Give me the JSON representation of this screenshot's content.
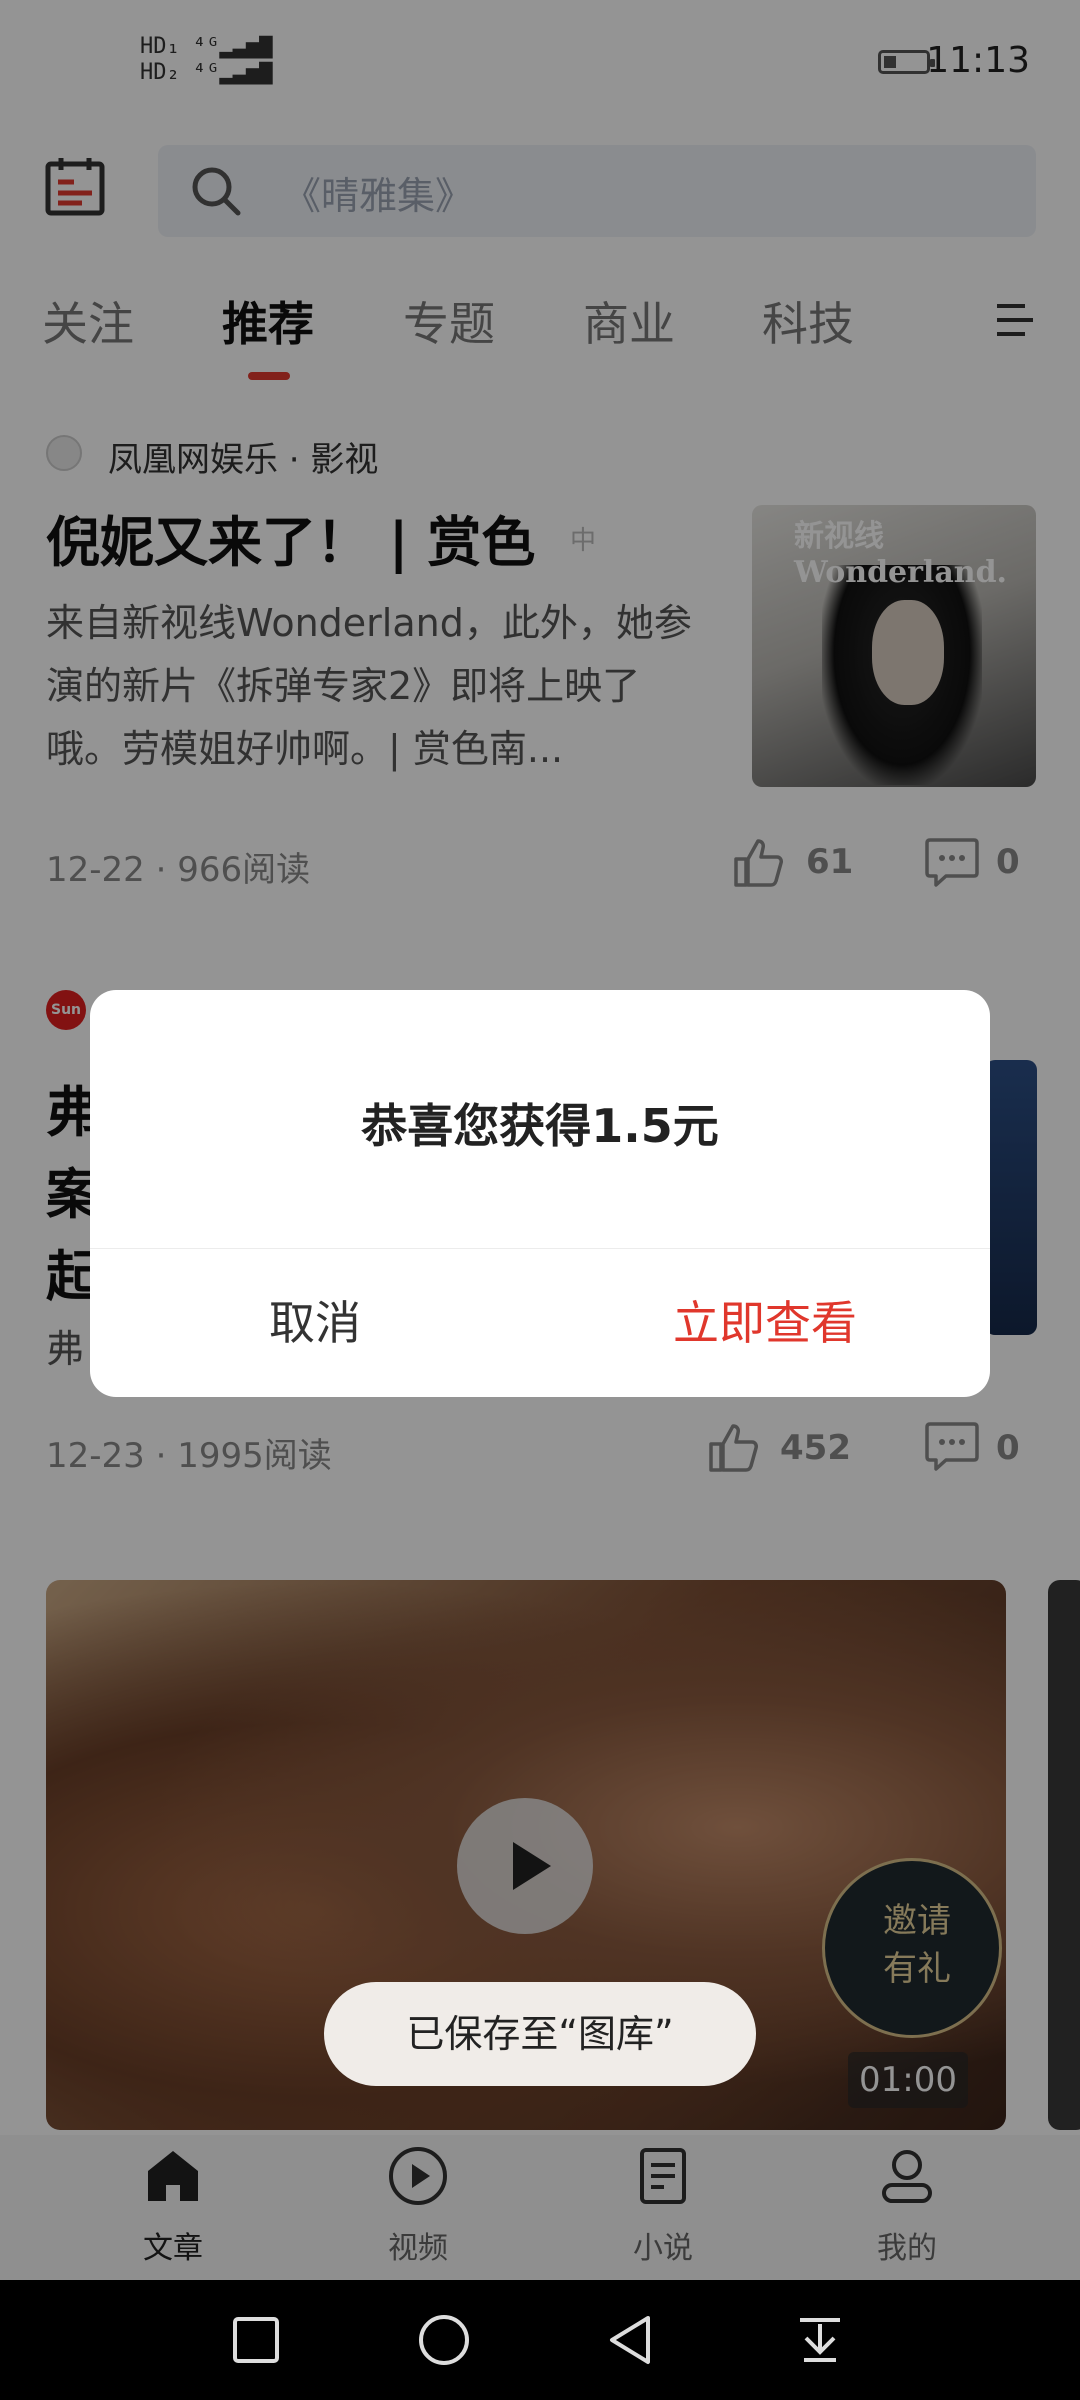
{
  "status_bar": {
    "signal_1": "HD₁ ⁴ᴳ▂▃▅▇",
    "signal_2": "HD₂ ⁴ᴳ▂▃▅▇",
    "time": "11:13",
    "battery_level": 0.3
  },
  "header": {
    "search_placeholder": "《晴雅集》"
  },
  "tabs": [
    {
      "label": "关注",
      "active": false
    },
    {
      "label": "推荐",
      "active": true
    },
    {
      "label": "专题",
      "active": false
    },
    {
      "label": "商业",
      "active": false
    },
    {
      "label": "科技",
      "active": false
    }
  ],
  "articles": [
    {
      "source": "凤凰网娱乐 · 影视",
      "title": "倪妮又来了！ | 赏色",
      "tag": "中",
      "summary": "来自新视线Wonderland，此外，她参演的新片《拆弹专家2》即将上映了哦。劳模姐好帅啊。| 赏色南...",
      "thumbnail_text": "新视线 Wonderland.",
      "meta": "12-22 · 966阅读",
      "likes": "61",
      "comments": "0"
    },
    {
      "source_logo": "Sun",
      "title_lines": [
        "弗",
        "案",
        "起"
      ],
      "summary": "弗",
      "meta": "12-23 · 1995阅读",
      "likes": "452",
      "comments": "0"
    }
  ],
  "video": {
    "invite_line1": "邀请",
    "invite_line2": "有礼",
    "duration": "01:00"
  },
  "bottom_nav": [
    {
      "label": "文章",
      "icon": "home-icon",
      "active": true
    },
    {
      "label": "视频",
      "icon": "play-circle-icon",
      "active": false
    },
    {
      "label": "小说",
      "icon": "book-icon",
      "active": false
    },
    {
      "label": "我的",
      "icon": "user-icon",
      "active": false
    }
  ],
  "dialog": {
    "message": "恭喜您获得1.5元",
    "cancel_label": "取消",
    "confirm_label": "立即查看"
  },
  "toast": {
    "message": "已保存至“图库”"
  },
  "colors": {
    "accent": "#e0372c",
    "tab_underline": "#e03a30"
  }
}
